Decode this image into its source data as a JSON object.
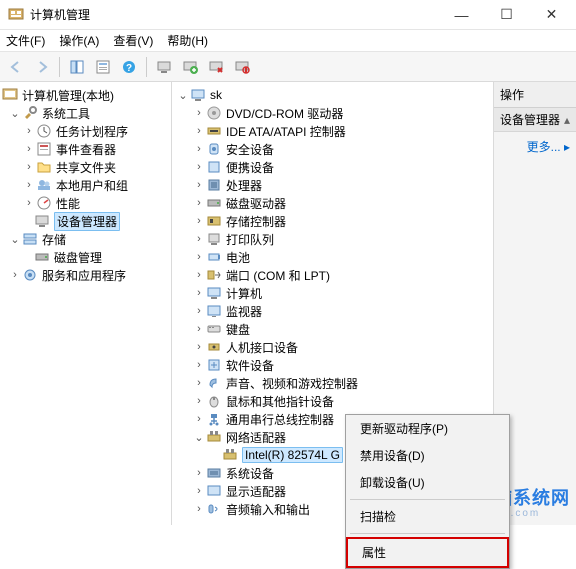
{
  "window": {
    "title": "计算机管理",
    "min": "—",
    "max": "☐",
    "close": "✕"
  },
  "menu": {
    "file": "文件(F)",
    "action": "操作(A)",
    "view": "查看(V)",
    "help": "帮助(H)"
  },
  "left_tree": {
    "root": "计算机管理(本地)",
    "sys_tools": "系统工具",
    "task_sched": "任务计划程序",
    "event_viewer": "事件查看器",
    "shared": "共享文件夹",
    "users": "本地用户和组",
    "perf": "性能",
    "dev_mgr": "设备管理器",
    "storage": "存储",
    "disk_mgmt": "磁盘管理",
    "services": "服务和应用程序"
  },
  "mid_tree": {
    "root": "sk",
    "items": [
      "DVD/CD-ROM 驱动器",
      "IDE ATA/ATAPI 控制器",
      "安全设备",
      "便携设备",
      "处理器",
      "磁盘驱动器",
      "存储控制器",
      "打印队列",
      "电池",
      "端口 (COM 和 LPT)",
      "计算机",
      "监视器",
      "键盘",
      "人机接口设备",
      "软件设备",
      "声音、视频和游戏控制器",
      "鼠标和其他指针设备",
      "通用串行总线控制器",
      "网络适配器",
      "系统设备",
      "显示适配器",
      "音频输入和输出"
    ],
    "net_child": "Intel(R) 82574L G",
    "expanded_index": 18
  },
  "right": {
    "header": "操作",
    "sub": "设备管理器",
    "more": "更多..."
  },
  "ctx": {
    "update": "更新驱动程序(P)",
    "disable": "禁用设备(D)",
    "uninstall": "卸载设备(U)",
    "scan": "扫描检",
    "props": "属性"
  },
  "watermark": {
    "text": "电脑系统网",
    "sub": "dnxtw.com"
  }
}
